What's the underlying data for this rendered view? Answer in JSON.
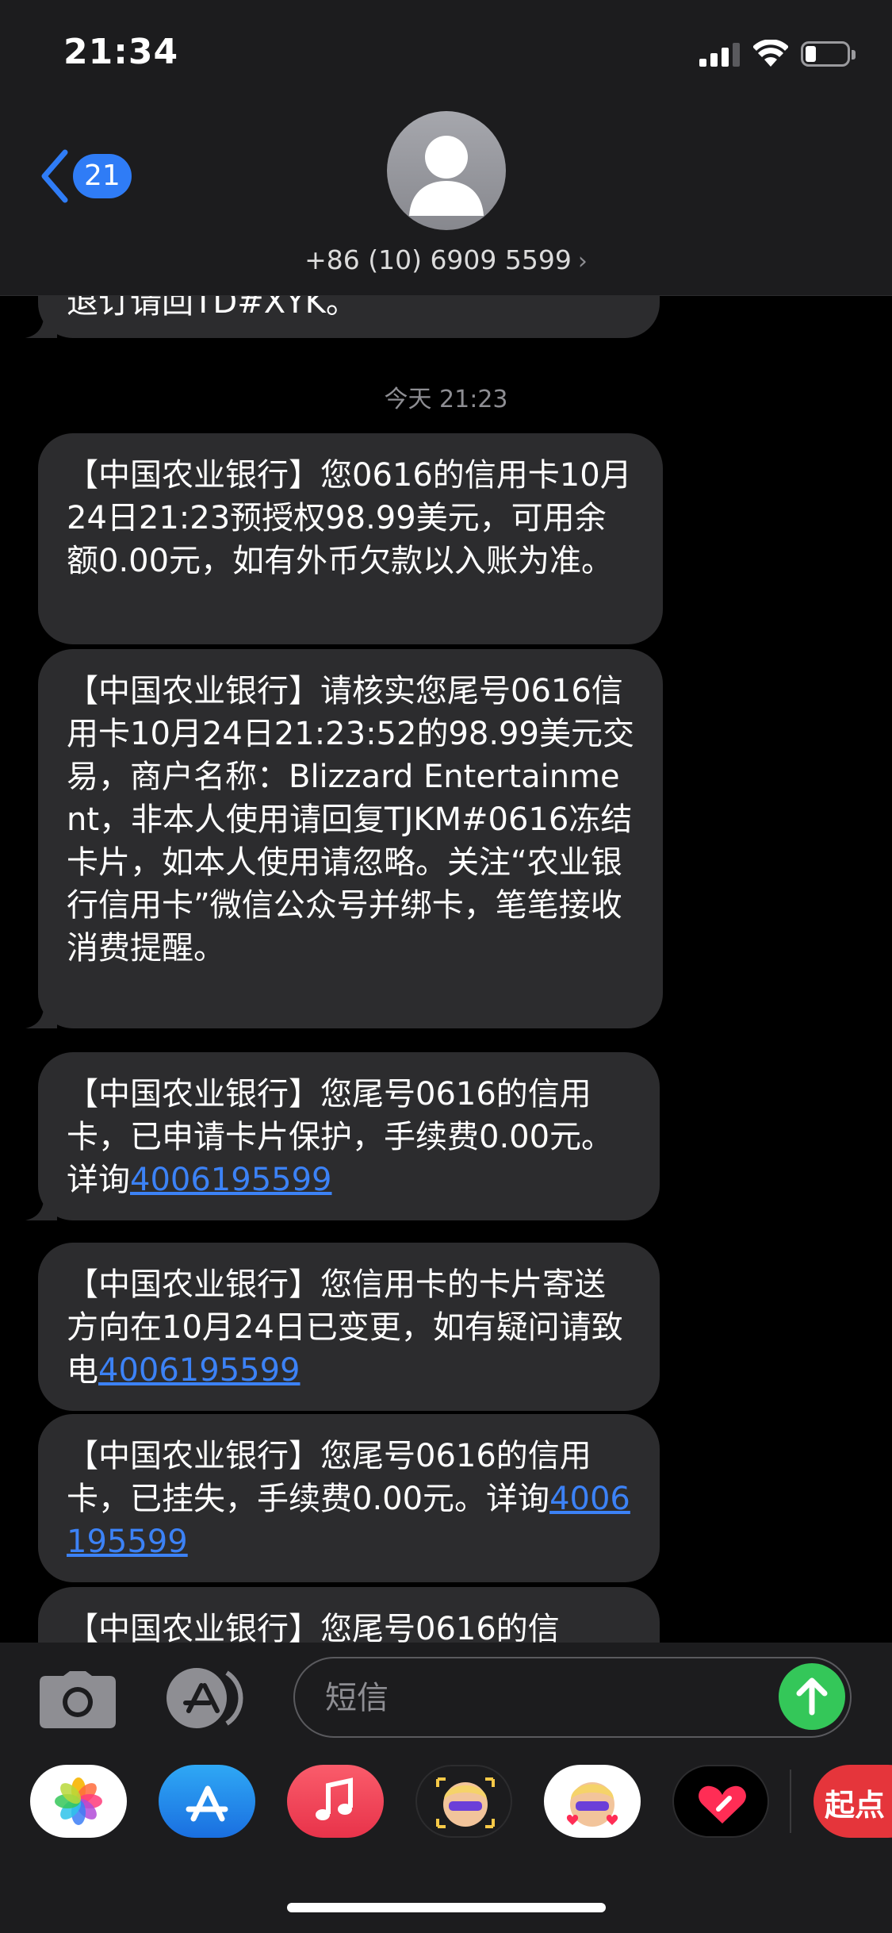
{
  "status_bar": {
    "time": "21:34"
  },
  "header": {
    "back_count": "21",
    "contact": "+86 (10) 6909 5599"
  },
  "messages": {
    "prev_fragment": "退订请回TD#XYK。",
    "timestamp": "今天 21:23",
    "m1": "【中国农业银行】您0616的信用卡10月24日21:23预授权98.99美元，可用余额0.00元，如有外币欠款以入账为准。",
    "m2": "【中国农业银行】请核实您尾号0616信用卡10月24日21:23:52的98.99美元交易，商户名称：Blizzard Entertainment，非本人使用请回复TJKM#0616冻结卡片，如本人使用请忽略。关注“农业银行信用卡”微信公众号并绑卡，笔笔接收消费提醒。",
    "m3_text": "【中国农业银行】您尾号0616的信用卡，已申请卡片保护，手续费0.00元。详询",
    "m3_link": "4006195599",
    "m4_text": "【中国农业银行】您信用卡的卡片寄送方向在10月24日已变更，如有疑问请致电",
    "m4_link": "4006195599",
    "m5_text": "【中国农业银行】您尾号0616的信用卡，已挂失，手续费0.00元。详询",
    "m5_link": "4006195599",
    "m6_fragment": "【中国农业银行】您尾号0616的信"
  },
  "input": {
    "placeholder": "短信"
  },
  "drawer": {
    "qidian_label": "起点"
  },
  "colors": {
    "bubble": "#2c2c2e",
    "link": "#3c82f6",
    "send": "#34c759",
    "badge": "#2f7cf6"
  }
}
